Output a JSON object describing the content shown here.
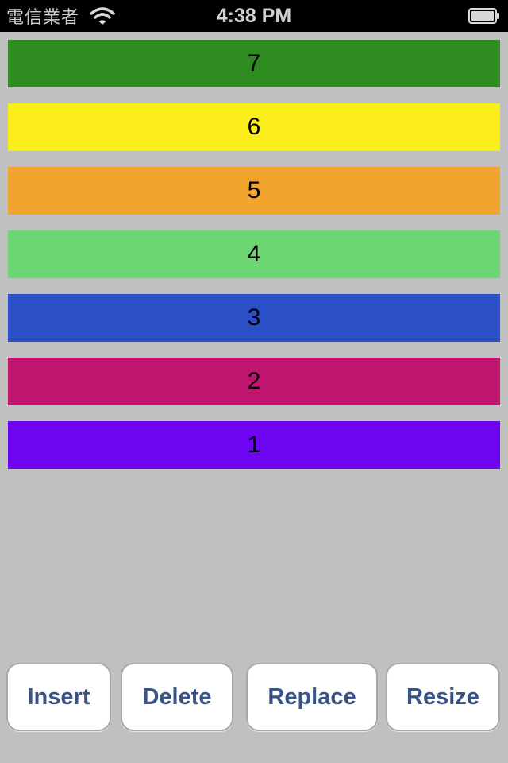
{
  "status_bar": {
    "carrier": "電信業者",
    "time": "4:38 PM",
    "wifi_icon": "wifi-icon",
    "battery_icon": "battery-icon"
  },
  "rows": [
    {
      "label": "7",
      "color": "#2e8b1f"
    },
    {
      "label": "6",
      "color": "#fbee1a"
    },
    {
      "label": "5",
      "color": "#f2a52e"
    },
    {
      "label": "4",
      "color": "#6bd672"
    },
    {
      "label": "3",
      "color": "#2b4fc7"
    },
    {
      "label": "2",
      "color": "#be166e"
    },
    {
      "label": "1",
      "color": "#6e05f2"
    }
  ],
  "toolbar": {
    "insert_label": "Insert",
    "delete_label": "Delete",
    "replace_label": "Replace",
    "resize_label": "Resize"
  },
  "colors": {
    "background": "#c0c0c0",
    "button_text": "#385487",
    "status_bar": "#000000"
  }
}
